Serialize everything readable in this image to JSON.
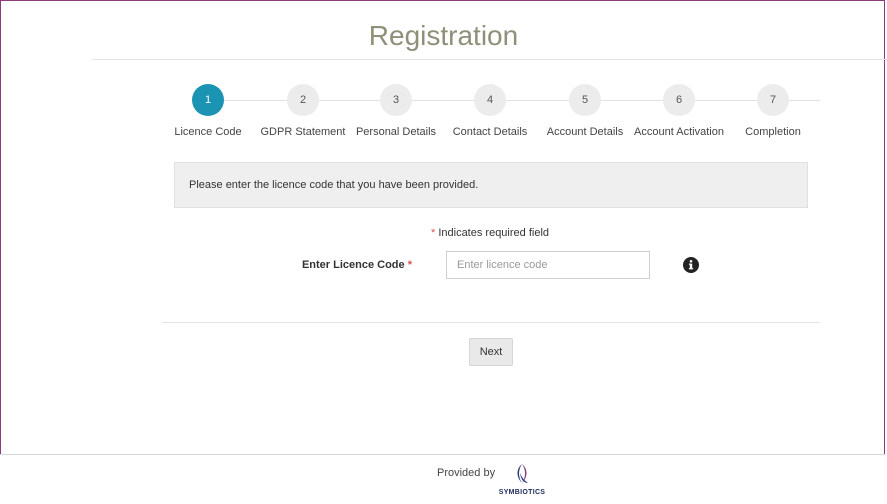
{
  "page": {
    "title": "Registration"
  },
  "steps": [
    {
      "number": "1",
      "label": "Licence Code",
      "active": true
    },
    {
      "number": "2",
      "label": "GDPR Statement",
      "active": false
    },
    {
      "number": "3",
      "label": "Personal Details",
      "active": false
    },
    {
      "number": "4",
      "label": "Contact Details",
      "active": false
    },
    {
      "number": "5",
      "label": "Account Details",
      "active": false
    },
    {
      "number": "6",
      "label": "Account Activation",
      "active": false
    },
    {
      "number": "7",
      "label": "Completion",
      "active": false
    }
  ],
  "info_box": {
    "text": "Please enter the licence code that you have been provided."
  },
  "form": {
    "required_star": "*",
    "required_note": "Indicates required field",
    "licence_label": "Enter Licence Code",
    "licence_value": "",
    "licence_placeholder": "Enter licence code",
    "info_icon": "info-circle-icon"
  },
  "actions": {
    "next_label": "Next"
  },
  "footer": {
    "provided_by": "Provided by",
    "brand": "SYMBIOTICS"
  },
  "colors": {
    "accent": "#1b93b3",
    "required": "#d9534f",
    "frame": "#8a3d78"
  }
}
